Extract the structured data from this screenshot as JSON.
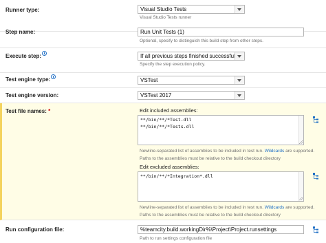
{
  "runner_type": {
    "label": "Runner type:",
    "value": "Visual Studio Tests",
    "hint": "Visual Studio Tests runner"
  },
  "step_name": {
    "label": "Step name:",
    "value": "Run Unit Tests (1)",
    "hint": "Optional, specify to distinguish this build step from other steps."
  },
  "execute_step": {
    "label": "Execute step:",
    "value": "If all previous steps finished successfully",
    "hint": "Specify the step execution policy."
  },
  "test_engine_type": {
    "label": "Test engine type:",
    "value": "VSTest"
  },
  "test_engine_version": {
    "label": "Test engine version:",
    "value": "VSTest 2017"
  },
  "test_file_names": {
    "label": "Test file names:",
    "required_mark": "*",
    "included": {
      "label": "Edit included assemblies:",
      "lines": [
        "**/bin/**/*Test.dll",
        "**/bin/**/*Tests.dll"
      ],
      "hint_prefix": "Newline-separated list of assemblies to be included in test run.",
      "hint_link": "Wildcards",
      "hint_suffix": "are supported.",
      "hint2": "Paths to the assemblies must be relative to the build checkout directory"
    },
    "excluded": {
      "label": "Edit excluded assemblies:",
      "lines": [
        "**/bin/**/*Integration*.dll"
      ],
      "hint_prefix": "Newline-separated list of assemblies to be included in test run.",
      "hint_link": "Wildcards",
      "hint_suffix": "are supported.",
      "hint2": "Paths to the assemblies must be relative to the build checkout directory"
    }
  },
  "run_configuration_file": {
    "label": "Run configuration file:",
    "value": "%teamcity.build.workingDir%\\Project\\Project.runsettings",
    "hint": "Path to run settings configuration file"
  },
  "icons": {
    "help": "help-icon",
    "tree": "tree-picker-icon",
    "dropdown": "chevron-down-icon"
  },
  "colors": {
    "highlight_bg": "#fffde6",
    "highlight_border": "#f4d35e",
    "link": "#1f6fc5",
    "required": "#d00000"
  }
}
